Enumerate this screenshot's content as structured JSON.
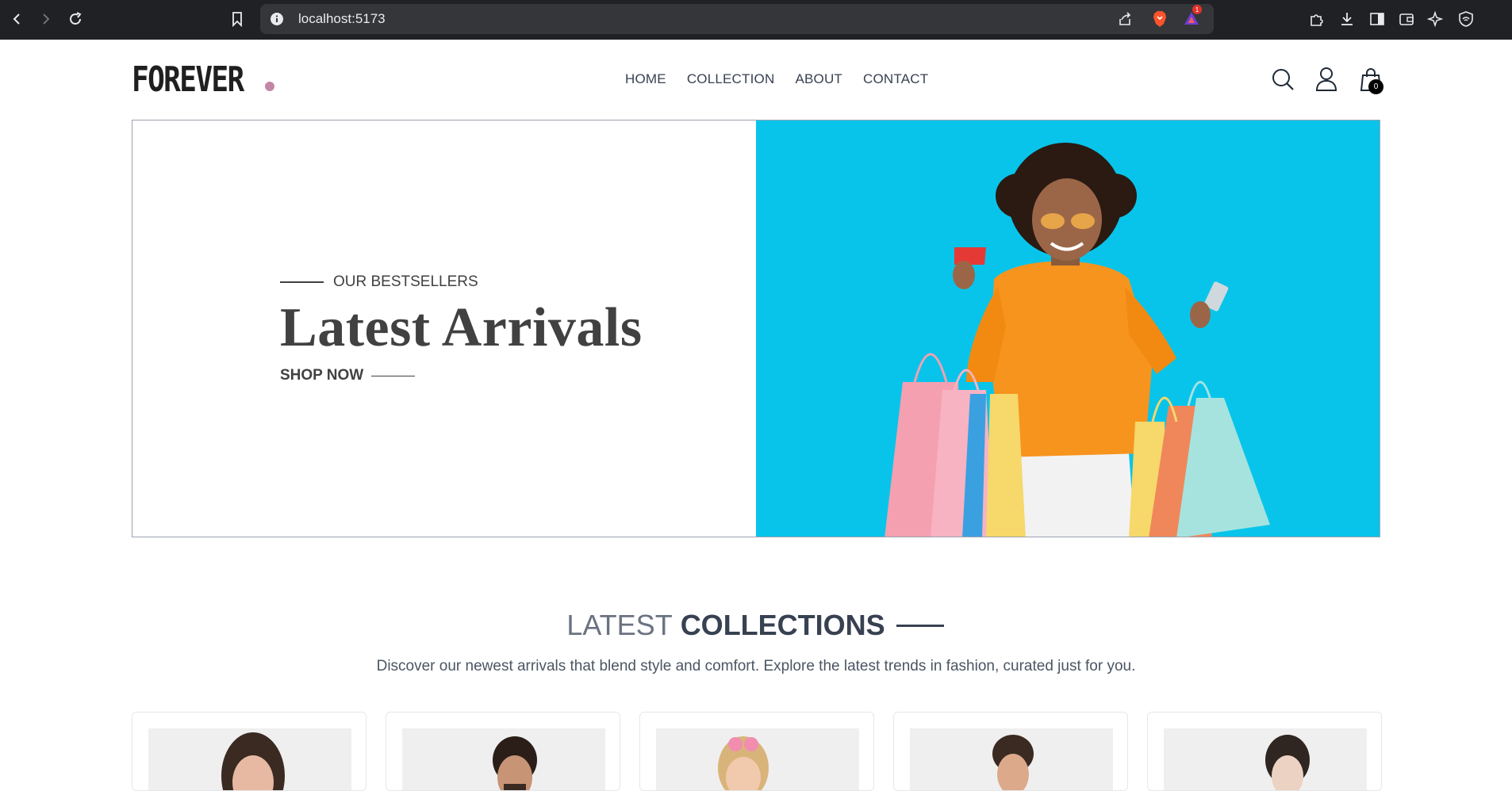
{
  "browser": {
    "url": "localhost:5173",
    "alert_badge": "1"
  },
  "header": {
    "logo": "FOREVER",
    "nav": [
      "HOME",
      "COLLECTION",
      "ABOUT",
      "CONTACT"
    ],
    "cart_count": "0",
    "colors": {
      "logo_dot": "#c586a5"
    }
  },
  "hero": {
    "eyebrow": "OUR BESTSELLERS",
    "title": "Latest Arrivals",
    "cta": "SHOP NOW",
    "bg_color": "#08c4ea"
  },
  "latest": {
    "title_light": "LATEST",
    "title_bold": "COLLECTIONS",
    "description": "Discover our newest arrivals that blend style and comfort. Explore the latest trends in fashion, curated just for you."
  },
  "products": [
    {
      "thumb": "woman-portrait"
    },
    {
      "thumb": "man-portrait"
    },
    {
      "thumb": "girl-sunglasses"
    },
    {
      "thumb": "boy-portrait"
    },
    {
      "thumb": "woman-portrait-2"
    }
  ]
}
